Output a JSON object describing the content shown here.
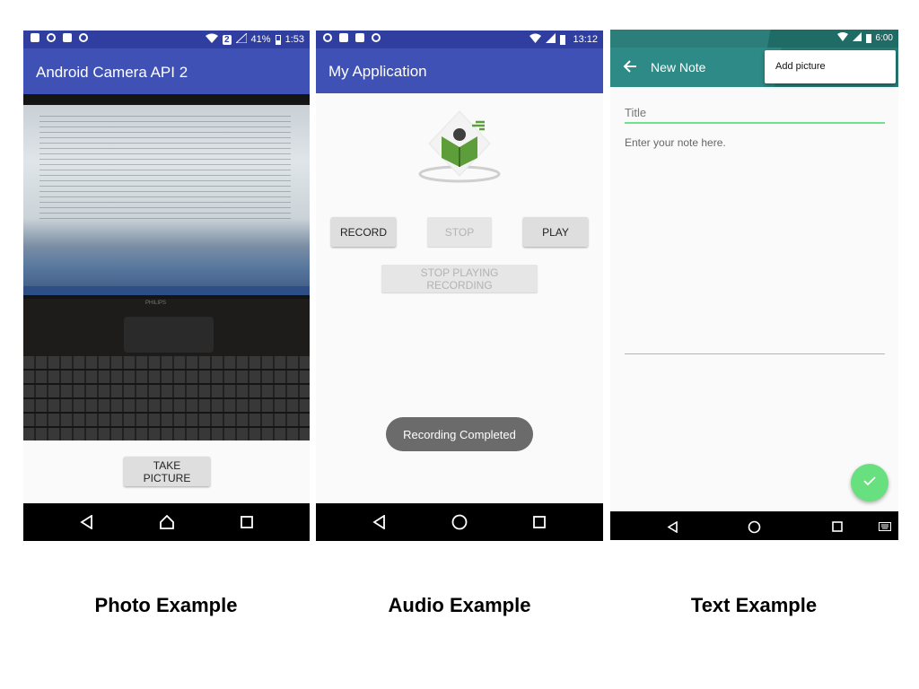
{
  "photo": {
    "status_battery": "41%",
    "status_time": "1:53",
    "status_badge": "2",
    "title": "Android Camera API 2",
    "take_picture_label": "TAKE PICTURE",
    "monitor_brand": "PHILIPS",
    "caption": "Photo Example"
  },
  "audio": {
    "status_time": "13:12",
    "title": "My Application",
    "record_label": "RECORD",
    "stop_label": "STOP",
    "play_label": "PLAY",
    "stop_playing_label": "STOP PLAYING RECORDING",
    "toast": "Recording Completed",
    "caption": "Audio Example"
  },
  "text": {
    "status_time": "6:00",
    "title": "New Note",
    "menu_item": "Add picture",
    "title_placeholder": "Title",
    "note_placeholder": "Enter your note here.",
    "caption": "Text Example"
  },
  "colors": {
    "photo_appbar": "#3f51b5",
    "audio_appbar": "#3f51b5",
    "note_toolbar": "#2e8a86",
    "fab": "#69e07f"
  }
}
